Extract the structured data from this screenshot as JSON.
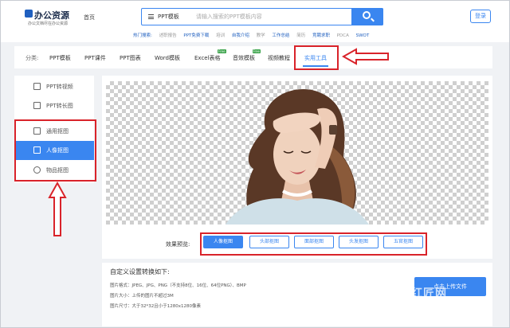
{
  "brand": {
    "title": "办公资源",
    "subtitle": "办公文档尽在办公资源"
  },
  "header": {
    "home": "首页",
    "search_category": "PPT模板",
    "search_placeholder": "请输入搜索的PPT模板内容",
    "login": "登录",
    "hot_label": "热门搜索:",
    "hot_terms": [
      "述职报告",
      "PPT免费下载",
      "培训",
      "自我介绍",
      "教学",
      "工作总结",
      "简历",
      "竞聘求职",
      "PDCA",
      "SWOT"
    ]
  },
  "categories": {
    "label": "分类:",
    "items": [
      {
        "label": "PPT模板",
        "free": ""
      },
      {
        "label": "PPT课件",
        "free": ""
      },
      {
        "label": "PPT图表",
        "free": ""
      },
      {
        "label": "Word模板",
        "free": ""
      },
      {
        "label": "Excel表格",
        "free": "Free"
      },
      {
        "label": "音效模板",
        "free": "Free"
      },
      {
        "label": "视频教程",
        "free": ""
      },
      {
        "label": "实用工具",
        "free": ""
      }
    ],
    "active_index": 7
  },
  "sidebar": {
    "items": [
      {
        "label": "PPT转视频",
        "icon": "play-icon"
      },
      {
        "label": "PPT转长图",
        "icon": "image-icon"
      },
      {
        "label": "通用抠图",
        "icon": "frame-icon"
      },
      {
        "label": "人像抠图",
        "icon": "portrait-icon"
      },
      {
        "label": "物品抠图",
        "icon": "object-icon"
      }
    ],
    "active_index": 3
  },
  "preview": {
    "label": "效果预览:",
    "effects": [
      "人像抠图",
      "头部抠图",
      "面部抠图",
      "头发抠图",
      "五官抠图"
    ],
    "active_index": 0
  },
  "info": {
    "title": "自定义设置转换如下:",
    "lines": [
      "图片格式：JPEG、JPG、PNG（不支持8位、16位、64位PNG）、BMP",
      "图片大小：上传的图片不超过3M",
      "图片尺寸：大于32*32且小于1280x1280像素"
    ],
    "upload": "点击上传文件",
    "watermark": "红匠网"
  },
  "colors": {
    "accent": "#3a86f0",
    "annotation": "#d9232a"
  }
}
